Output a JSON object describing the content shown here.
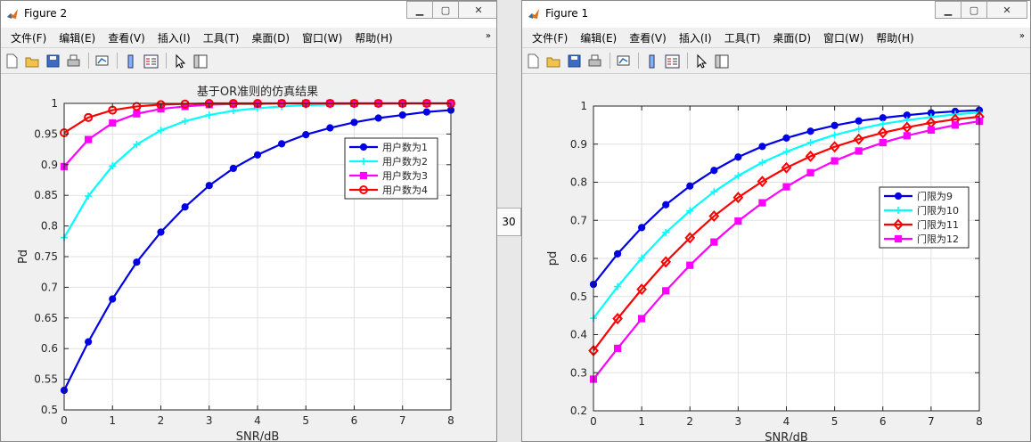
{
  "menu": [
    "文件(F)",
    "编辑(E)",
    "查看(V)",
    "插入(I)",
    "工具(T)",
    "桌面(D)",
    "窗口(W)",
    "帮助(H)"
  ],
  "menu_overflow_icon": "double-chevron-icon",
  "window_controls": {
    "minimize": "minimize-icon",
    "maximize": "maximize-icon",
    "close": "close-icon"
  },
  "toolbar_icons": [
    "new-figure-icon",
    "open-file-icon",
    "save-icon",
    "print-icon",
    "link-plot-icon",
    "colorbar-icon",
    "legend-icon",
    "pointer-icon",
    "property-editor-icon"
  ],
  "background_tab_label": "30",
  "windows": [
    {
      "title": "Figure 2",
      "chart_data": {
        "type": "line",
        "title": "基于OR准则的仿真结果",
        "xlabel": "SNR/dB",
        "ylabel": "Pd",
        "xlim": [
          0,
          8
        ],
        "ylim": [
          0.5,
          1
        ],
        "xticks": [
          0,
          1,
          2,
          3,
          4,
          5,
          6,
          7,
          8
        ],
        "yticks": [
          0.5,
          0.55,
          0.6,
          0.65,
          0.7,
          0.75,
          0.8,
          0.85,
          0.9,
          0.95,
          1
        ],
        "grid": true,
        "legend_position": "upper-right",
        "x": [
          0,
          0.5,
          1,
          1.5,
          2,
          2.5,
          3,
          3.5,
          4,
          4.5,
          5,
          5.5,
          6,
          6.5,
          7,
          7.5,
          8
        ],
        "series": [
          {
            "name": "用户数为1",
            "color": "#0000e6",
            "marker": "circle",
            "values": [
              0.532,
              0.611,
              0.681,
              0.741,
              0.79,
              0.831,
              0.866,
              0.894,
              0.916,
              0.934,
              0.949,
              0.96,
              0.969,
              0.976,
              0.981,
              0.986,
              0.989
            ]
          },
          {
            "name": "用户数为2",
            "color": "#00ffff",
            "marker": "plus",
            "values": [
              0.781,
              0.849,
              0.898,
              0.933,
              0.956,
              0.971,
              0.981,
              0.988,
              0.992,
              0.995,
              0.997,
              0.998,
              0.999,
              0.999,
              1.0,
              1.0,
              1.0
            ]
          },
          {
            "name": "用户数为3",
            "color": "#ff00ff",
            "marker": "square",
            "values": [
              0.897,
              0.941,
              0.968,
              0.983,
              0.991,
              0.995,
              0.998,
              0.999,
              0.999,
              1.0,
              1.0,
              1.0,
              1.0,
              1.0,
              1.0,
              1.0,
              1.0
            ]
          },
          {
            "name": "用户数为4",
            "color": "#ff0000",
            "marker": "circle-open",
            "values": [
              0.952,
              0.977,
              0.989,
              0.995,
              0.998,
              0.999,
              1.0,
              1.0,
              1.0,
              1.0,
              1.0,
              1.0,
              1.0,
              1.0,
              1.0,
              1.0,
              1.0
            ]
          }
        ]
      }
    },
    {
      "title": "Figure 1",
      "chart_data": {
        "type": "line",
        "title": "",
        "xlabel": "SNR/dB",
        "ylabel": "pd",
        "xlim": [
          0,
          8
        ],
        "ylim": [
          0.2,
          1
        ],
        "xticks": [
          0,
          1,
          2,
          3,
          4,
          5,
          6,
          7,
          8
        ],
        "yticks": [
          0.2,
          0.3,
          0.4,
          0.5,
          0.6,
          0.7,
          0.8,
          0.9,
          1
        ],
        "grid": true,
        "legend_position": "right",
        "x": [
          0,
          0.5,
          1,
          1.5,
          2,
          2.5,
          3,
          3.5,
          4,
          4.5,
          5,
          5.5,
          6,
          6.5,
          7,
          7.5,
          8
        ],
        "series": [
          {
            "name": "门限为9",
            "color": "#0000e6",
            "marker": "circle",
            "values": [
              0.532,
              0.612,
              0.681,
              0.741,
              0.79,
              0.831,
              0.866,
              0.894,
              0.916,
              0.934,
              0.949,
              0.961,
              0.969,
              0.976,
              0.982,
              0.986,
              0.989
            ]
          },
          {
            "name": "门限为10",
            "color": "#00ffff",
            "marker": "plus",
            "values": [
              0.443,
              0.526,
              0.601,
              0.668,
              0.725,
              0.775,
              0.817,
              0.852,
              0.88,
              0.904,
              0.924,
              0.94,
              0.953,
              0.963,
              0.971,
              0.978,
              0.983
            ]
          },
          {
            "name": "门限为11",
            "color": "#ff0000",
            "marker": "diamond",
            "values": [
              0.358,
              0.442,
              0.519,
              0.591,
              0.654,
              0.711,
              0.76,
              0.802,
              0.838,
              0.868,
              0.893,
              0.913,
              0.93,
              0.944,
              0.956,
              0.965,
              0.972
            ]
          },
          {
            "name": "门限为12",
            "color": "#ff00ff",
            "marker": "square",
            "values": [
              0.283,
              0.364,
              0.442,
              0.515,
              0.582,
              0.643,
              0.698,
              0.746,
              0.788,
              0.825,
              0.856,
              0.882,
              0.904,
              0.922,
              0.937,
              0.95,
              0.96
            ]
          }
        ]
      }
    }
  ]
}
